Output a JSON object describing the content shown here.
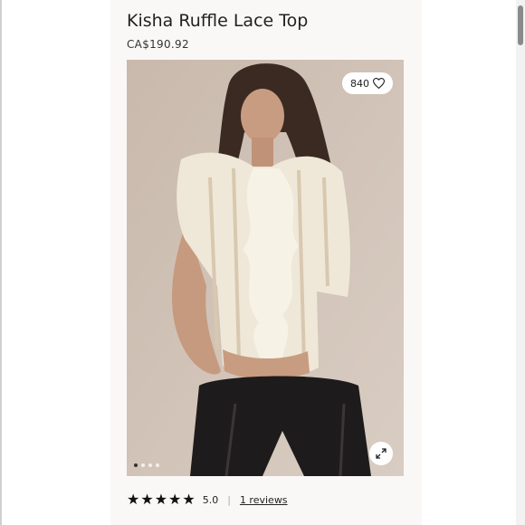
{
  "product": {
    "title": "Kisha Ruffle Lace Top",
    "price": "CA$190.92",
    "like_count": "840",
    "rating": {
      "stars": 5,
      "value": "5.0",
      "separator": "|",
      "reviews_label": "1 reviews"
    },
    "image": {
      "carousel_total": 4,
      "carousel_active": 1
    }
  },
  "icons": {
    "like": "heart-icon",
    "expand": "expand-arrows-icon",
    "star": "star-icon"
  },
  "colors": {
    "panel_bg": "#faf8f6",
    "text": "#222222",
    "star": "#111111"
  }
}
